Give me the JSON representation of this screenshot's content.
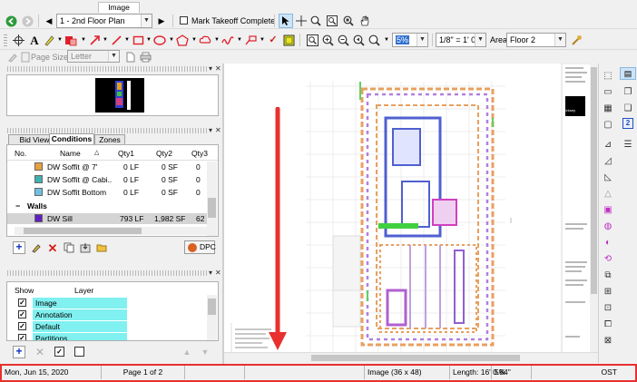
{
  "tab": {
    "label": "Image"
  },
  "toolbar1": {
    "page_select": "1 - 2nd Floor Plan",
    "mark_takeoff_label": "Mark Takeoff Complete",
    "icons": [
      "back-icon",
      "forward-icon",
      "prev-page-icon",
      "next-page-icon",
      "pointer-icon",
      "crosshair-icon",
      "zoom-in-icon",
      "zoom-window-icon",
      "zoom-fit-icon",
      "pan-hand-icon"
    ]
  },
  "toolbar2": {
    "zoom_value": "5%",
    "scale_value": "1/8\" = 1' 0\"",
    "area_label": "Area",
    "area_value": "Floor 2",
    "colors": {
      "rect": "#e0202c",
      "highlight": "#f0e020",
      "fill_yellow": "#f2e21a"
    }
  },
  "toolbar3": {
    "page_size_label": "Page Size",
    "page_size_value": "Letter"
  },
  "tabs": {
    "bid_view": "Bid View",
    "conditions": "Conditions",
    "zones": "Zones"
  },
  "conditions_table": {
    "headers": {
      "no": "No.",
      "name": "Name",
      "qty1": "Qty1",
      "qty2": "Qty2",
      "qty3": "Qty3"
    },
    "rows": [
      {
        "name": "DW Soffit @ 7'",
        "qty1": "0 LF",
        "qty2": "0 SF",
        "qty3": "0",
        "color": "#e8a040"
      },
      {
        "name": "DW Soffit @ Cabi...",
        "qty1": "0 LF",
        "qty2": "0 SF",
        "qty3": "0",
        "color": "#40b0b0"
      },
      {
        "name": "DW Soffit Bottom",
        "qty1": "0 LF",
        "qty2": "0 SF",
        "qty3": "0",
        "color": "#70c0e0"
      }
    ],
    "group": {
      "name": "Walls"
    },
    "walls_rows": [
      {
        "name": "DW Sill",
        "qty1": "793 LF",
        "qty2": "1,982 SF",
        "qty3": "62",
        "color": "#6020c0"
      }
    ],
    "dpc_label": "DPC"
  },
  "layers_table": {
    "headers": {
      "show": "Show",
      "layer": "Layer"
    },
    "rows": [
      {
        "name": "Image",
        "checked": "✓"
      },
      {
        "name": "Annotation",
        "checked": "✓"
      },
      {
        "name": "Default",
        "checked": "✓"
      },
      {
        "name": "Partitions",
        "checked": "✓"
      }
    ]
  },
  "drawing": {
    "title_block": {
      "firm": "Kirksey"
    }
  },
  "status_bar": {
    "date": "Mon, Jun 15, 2020",
    "page": "Page 1 of 2",
    "image": "Image (36 x 48)",
    "length": "Length: 16' 0.84\"",
    "zoom": "5%",
    "mode": "OST"
  },
  "annotation": {
    "arrow_color": "#e8302e",
    "box_color": "#e8302e"
  }
}
